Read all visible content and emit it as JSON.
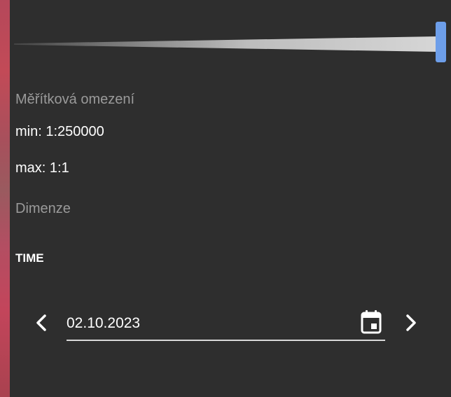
{
  "scale_constraints": {
    "label": "Měřítková omezení",
    "min": "min: 1:250000",
    "max": "max: 1:1"
  },
  "dimensions": {
    "label": "Dimenze",
    "name": "TIME",
    "date_value": "02.10.2023",
    "prev_icon": "chevron-left-icon",
    "next_icon": "chevron-right-icon",
    "calendar_icon": "calendar-icon"
  },
  "colors": {
    "background": "#2e2e2e",
    "slider_handle": "#6d9ee9",
    "muted_text": "#9a9a9a",
    "text": "#ffffff"
  }
}
